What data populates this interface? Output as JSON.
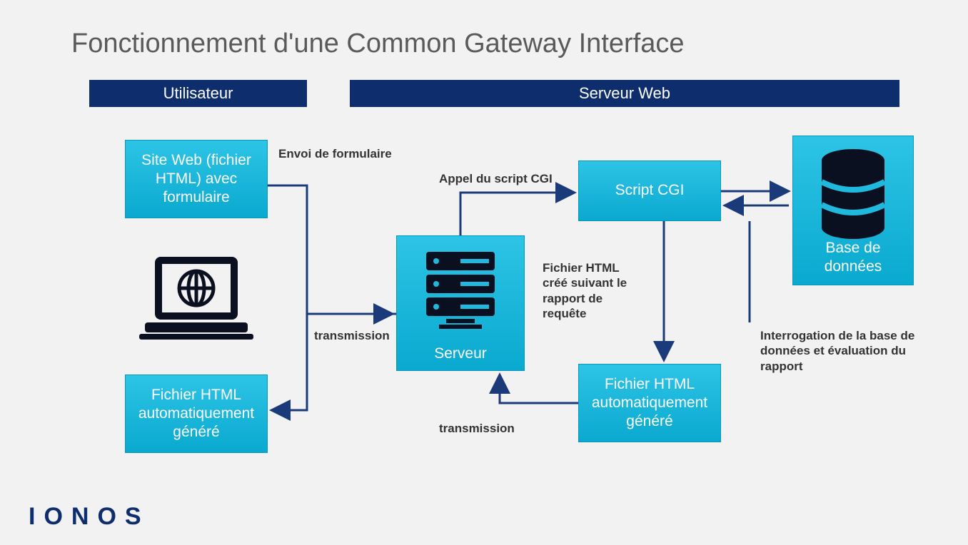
{
  "title": "Fonctionnement d'une Common Gateway Interface",
  "headers": {
    "user": "Utilisateur",
    "server": "Serveur Web"
  },
  "boxes": {
    "site": "Site Web (fichier HTML) avec formulaire",
    "file_u": "Fichier HTML automatiquement généré",
    "srv": "Serveur",
    "cgi": "Script CGI",
    "file_s": "Fichier HTML automatiquement généré",
    "db": "Base de données"
  },
  "annotations": {
    "send": "Envoi de formulaire",
    "call": "Appel du script CGI",
    "trans1": "transmission",
    "trans2": "transmission",
    "create": "Fichier HTML créé suivant le rapport de requête",
    "query": "Interrogation de la base de données et évaluation du rapport"
  },
  "brand": "IONOS"
}
